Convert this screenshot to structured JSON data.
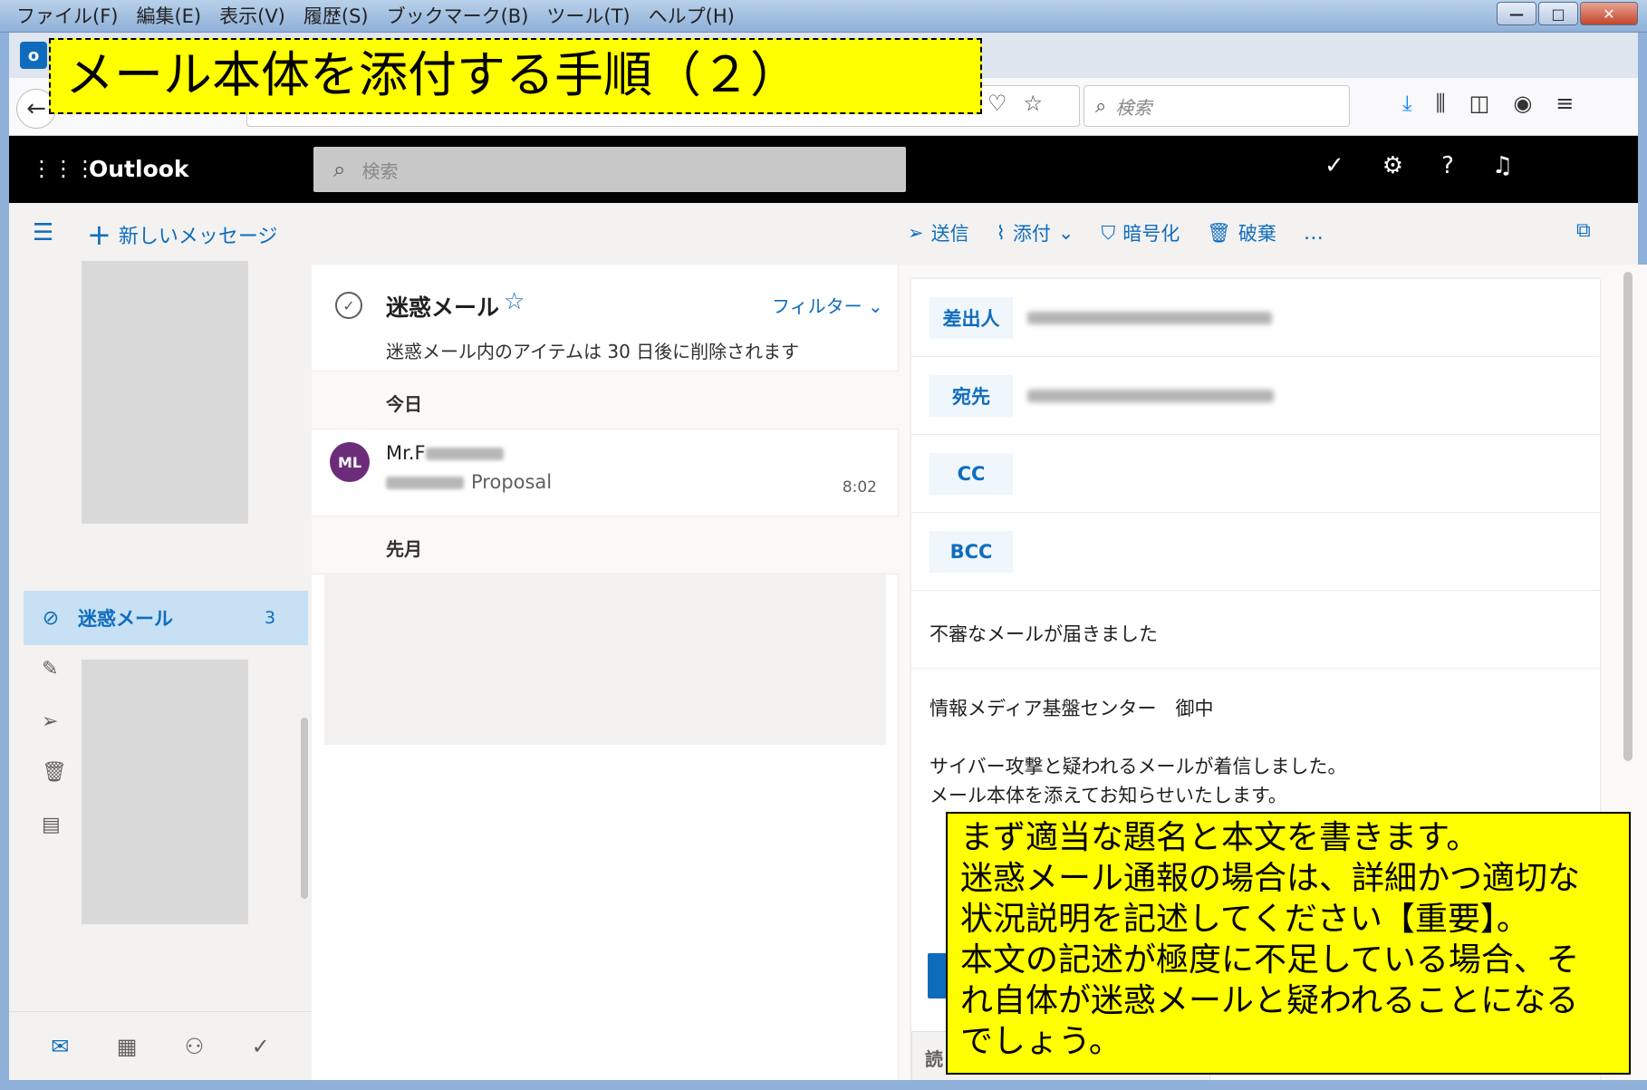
{
  "browser": {
    "menu": [
      "ファイル(F)",
      "編集(E)",
      "表示(V)",
      "履歴(S)",
      "ブックマーク(B)",
      "ツール(T)",
      "ヘルプ(H)"
    ],
    "search_placeholder": "検索"
  },
  "outlook": {
    "brand": "Outlook",
    "search_placeholder": "検索",
    "new_message": "新しいメッセージ",
    "commands": {
      "send": "送信",
      "attach": "添付",
      "encrypt": "暗号化",
      "discard": "破棄",
      "more": "…"
    },
    "folders": {
      "junk_label": "迷惑メール",
      "junk_count": "3"
    },
    "message_list": {
      "title": "迷惑メール",
      "filter": "フィルター",
      "notice": "迷惑メール内のアイテムは 30 日後に削除されます",
      "group_today": "今日",
      "group_last_month": "先月",
      "item": {
        "avatar": "ML",
        "sender": "Mr.F",
        "subject": "Proposal",
        "time": "8:02"
      }
    },
    "compose": {
      "from_label": "差出人",
      "to_label": "宛先",
      "cc_label": "CC",
      "bcc_label": "BCC",
      "subject": "不審なメールが届きました",
      "body": [
        "情報メディア基盤センター　御中",
        "サイバー攻撃と疑われるメールが着信しました。",
        "メール本体を添えてお知らせいたします。"
      ],
      "reading_tab": "読"
    }
  },
  "callouts": {
    "title": "メール本体を添付する手順（２）",
    "note": [
      "まず適当な題名と本文を書きます。",
      "迷惑メール通報の場合は、詳細かつ適切な",
      "状況説明を記述してください【重要】。",
      "本文の記述が極度に不足している場合、そ",
      "れ自体が迷惑メールと疑われることになる",
      "でしょう。"
    ]
  },
  "colors": {
    "accent": "#0f6cbd",
    "callout": "#ffff00",
    "avatar": "#6b2d7a"
  }
}
